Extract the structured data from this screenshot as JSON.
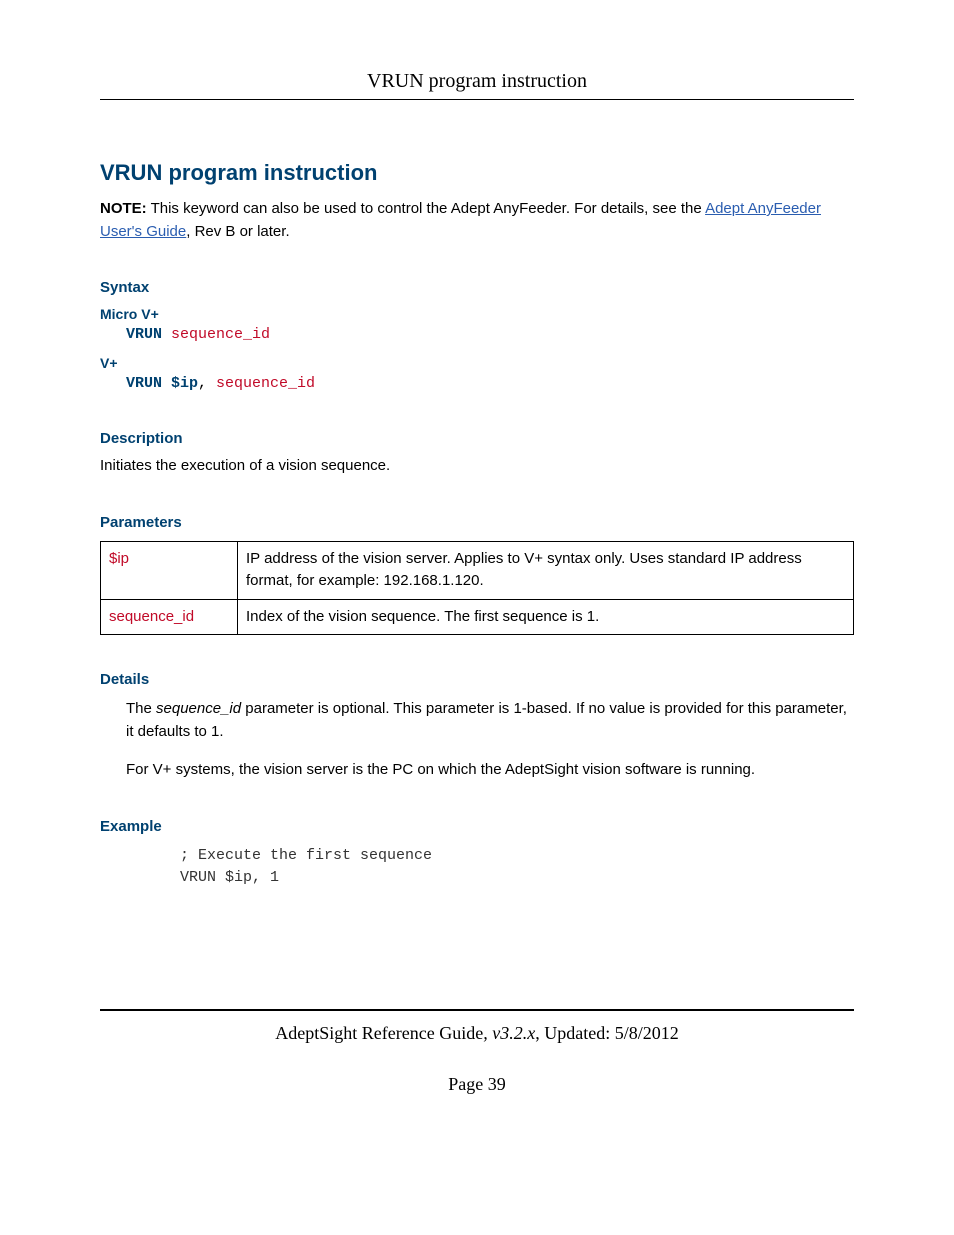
{
  "runningHead": "VRUN program instruction",
  "title": "VRUN program instruction",
  "note": {
    "label": "NOTE:",
    "text1": " This keyword can also be used to control the Adept AnyFeeder. For details, see the ",
    "linkText": "Adept AnyFeeder User's Guide",
    "text2": ", Rev B or later."
  },
  "syntax": {
    "heading": "Syntax",
    "micro": {
      "label": "Micro V+",
      "kw": "VRUN",
      "rest": " sequence_id"
    },
    "vplus": {
      "label": "V+",
      "kw": "VRUN $ip",
      "comma": ",",
      "rest": " sequence_id"
    }
  },
  "description": {
    "heading": "Description",
    "text": "Initiates the execution of a vision sequence."
  },
  "parameters": {
    "heading": "Parameters",
    "rows": [
      {
        "name": "$ip",
        "desc": "IP address of the vision server. Applies to V+ syntax only. Uses standard IP address format, for example: 192.168.1.120."
      },
      {
        "name": "sequence_id",
        "desc": "Index of the vision sequence. The first sequence is 1."
      }
    ]
  },
  "details": {
    "heading": "Details",
    "p1a": "The ",
    "p1b": "sequence_id",
    "p1c": " parameter is optional. This parameter is 1-based. If no value is provided for this parameter, it defaults to 1.",
    "p2": "For V+ systems, the vision server is the PC on which the AdeptSight vision software is running."
  },
  "example": {
    "heading": "Example",
    "line1": "; Execute the first sequence",
    "line2": "VRUN $ip, 1"
  },
  "footer": {
    "guide": "AdeptSight Reference Guide",
    "sep": ", ",
    "version": "v3.2.x",
    "updated": ", Updated: 5/8/2012",
    "pageLabel": "Page 39"
  }
}
